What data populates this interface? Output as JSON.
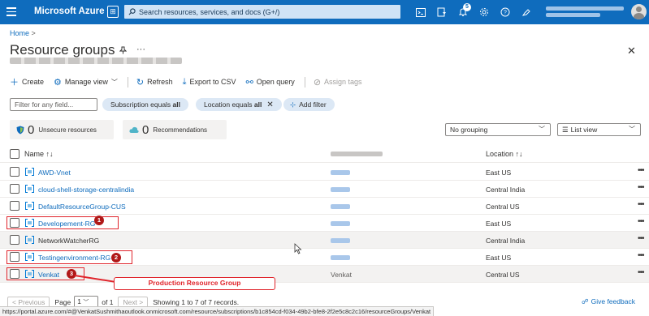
{
  "topbar": {
    "brand": "Microsoft Azure",
    "search_placeholder": "Search resources, services, and docs (G+/)",
    "notification_count": "5",
    "icons": [
      "menu-icon",
      "copilot-icon",
      "search-icon",
      "cloud-shell-icon",
      "directory-filter-icon",
      "bell-icon",
      "gear-icon",
      "help-icon",
      "feedback-icon",
      "avatar"
    ]
  },
  "breadcrumb": {
    "home": "Home",
    "separator": ">"
  },
  "page": {
    "title": "Resource groups",
    "more": "···",
    "close": "✕"
  },
  "commands": {
    "create": "Create",
    "manage_view": "Manage view",
    "refresh": "Refresh",
    "export_csv": "Export to CSV",
    "open_query": "Open query",
    "assign_tags": "Assign tags"
  },
  "filters": {
    "placeholder": "Filter for any field...",
    "subscription_prefix": "Subscription equals ",
    "subscription_value": "all",
    "location_prefix": "Location equals ",
    "location_value": "all",
    "add_filter": "Add filter"
  },
  "summary": {
    "unsecure_count": "0",
    "unsecure_label": "Unsecure resources",
    "recommend_count": "0",
    "recommend_label": "Recommendations"
  },
  "view": {
    "grouping": "No grouping",
    "list_view": "List view"
  },
  "table": {
    "headers": {
      "name": "Name ↑↓",
      "location": "Location ↑↓"
    },
    "rows": [
      {
        "name": "AWD-Vnet",
        "location": "East US",
        "subscription": ""
      },
      {
        "name": "cloud-shell-storage-centralindia",
        "location": "Central India",
        "subscription": ""
      },
      {
        "name": "DefaultResourceGroup-CUS",
        "location": "Central US",
        "subscription": ""
      },
      {
        "name": "Developement-RG",
        "location": "East US",
        "subscription": ""
      },
      {
        "name": "NetworkWatcherRG",
        "location": "Central India",
        "subscription": ""
      },
      {
        "name": "Testingenvironment-RG",
        "location": "East US",
        "subscription": ""
      },
      {
        "name": "Venkat",
        "location": "Central US",
        "subscription": "Venkat"
      }
    ]
  },
  "annotations": {
    "markers": [
      "1",
      "2",
      "3"
    ],
    "production_label": "Production Resource Group"
  },
  "pager": {
    "previous": "< Previous",
    "page_label": "Page",
    "page_value": "1",
    "of_label": "of 1",
    "next": "Next >",
    "showing": "Showing 1 to 7 of 7 records.",
    "feedback": "Give feedback"
  },
  "status_url": "https://portal.azure.com/#@VenkatSushmithaoutlook.onmicrosoft.com/resource/subscriptions/b1c854cd-f034-49b2-bfe8-2f2e5c8c2c16/resourceGroups/Venkat",
  "colors": {
    "azure_blue": "#0f6cbd",
    "annotation_red": "#e0242b"
  }
}
